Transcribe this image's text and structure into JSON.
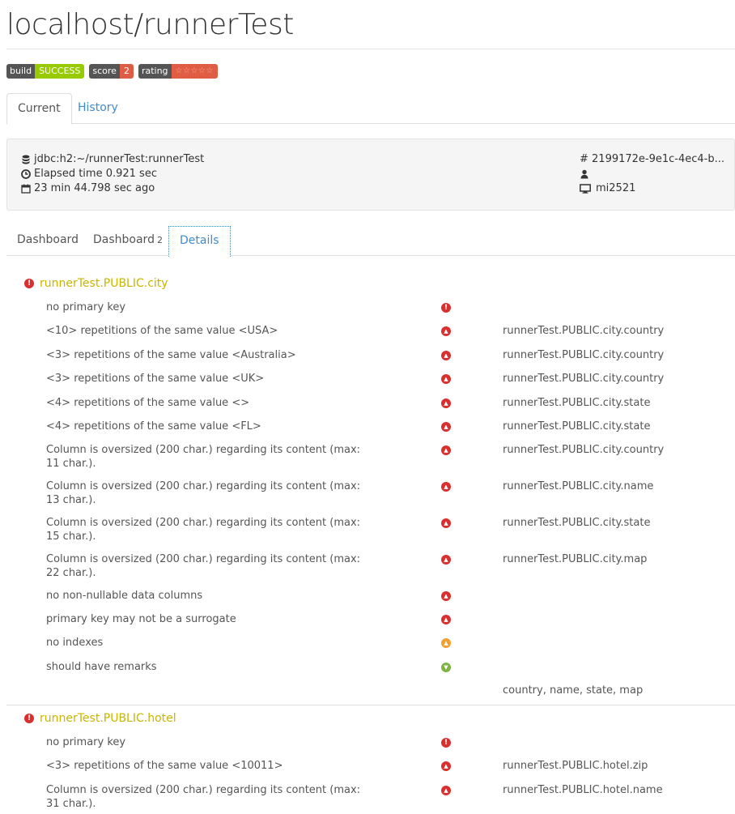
{
  "title": "localhost/runnerTest",
  "badges": {
    "build_key": "build",
    "build_value": "SUCCESS",
    "score_key": "score",
    "score_value": "2",
    "rating_key": "rating",
    "rating_value": "☆☆☆☆☆"
  },
  "tabs": {
    "current": "Current",
    "history": "History"
  },
  "info": {
    "connection": "jdbc:h2:~/runnerTest:runnerTest",
    "elapsed": "Elapsed time 0.921 sec",
    "ago": "23 min 44.798 sec ago",
    "hash": "# 2199172e-9e1c-4ec4-b...",
    "user": "",
    "host": "mi2521"
  },
  "subtabs": {
    "dashboard": "Dashboard",
    "dashboard2": "Dashboard",
    "dashboard2_count": "2",
    "details": "Details"
  },
  "sections": [
    {
      "title": "runnerTest.PUBLIC.city",
      "rows": [
        {
          "msg": "no primary key",
          "severity": "error",
          "ref": ""
        },
        {
          "msg": "<10> repetitions of the same value <USA>",
          "severity": "up",
          "ref": "runnerTest.PUBLIC.city.country"
        },
        {
          "msg": "<3> repetitions of the same value <Australia>",
          "severity": "up",
          "ref": "runnerTest.PUBLIC.city.country"
        },
        {
          "msg": "<3> repetitions of the same value <UK>",
          "severity": "up",
          "ref": "runnerTest.PUBLIC.city.country"
        },
        {
          "msg": "<4> repetitions of the same value <>",
          "severity": "up",
          "ref": "runnerTest.PUBLIC.city.state"
        },
        {
          "msg": "<4> repetitions of the same value <FL>",
          "severity": "up",
          "ref": "runnerTest.PUBLIC.city.state"
        },
        {
          "msg": "Column is oversized (200 char.) regarding its content (max: 11 char.).",
          "severity": "up",
          "ref": "runnerTest.PUBLIC.city.country"
        },
        {
          "msg": "Column is oversized (200 char.) regarding its content (max: 13 char.).",
          "severity": "up",
          "ref": "runnerTest.PUBLIC.city.name"
        },
        {
          "msg": "Column is oversized (200 char.) regarding its content (max: 15 char.).",
          "severity": "up",
          "ref": "runnerTest.PUBLIC.city.state"
        },
        {
          "msg": "Column is oversized (200 char.) regarding its content (max: 22 char.).",
          "severity": "up",
          "ref": "runnerTest.PUBLIC.city.map"
        },
        {
          "msg": "no non-nullable data columns",
          "severity": "up",
          "ref": ""
        },
        {
          "msg": "primary key may not be a surrogate",
          "severity": "up",
          "ref": ""
        },
        {
          "msg": "no indexes",
          "severity": "warn",
          "ref": ""
        },
        {
          "msg": "should have remarks",
          "severity": "ok",
          "ref": ""
        },
        {
          "msg": "",
          "severity": "",
          "ref": "country, name, state, map"
        }
      ]
    },
    {
      "title": "runnerTest.PUBLIC.hotel",
      "rows": [
        {
          "msg": "no primary key",
          "severity": "error",
          "ref": ""
        },
        {
          "msg": "<3> repetitions of the same value <10011>",
          "severity": "up",
          "ref": "runnerTest.PUBLIC.hotel.zip"
        },
        {
          "msg": "Column is oversized (200 char.) regarding its content (max: 31 char.).",
          "severity": "up",
          "ref": "runnerTest.PUBLIC.hotel.name"
        }
      ]
    }
  ]
}
